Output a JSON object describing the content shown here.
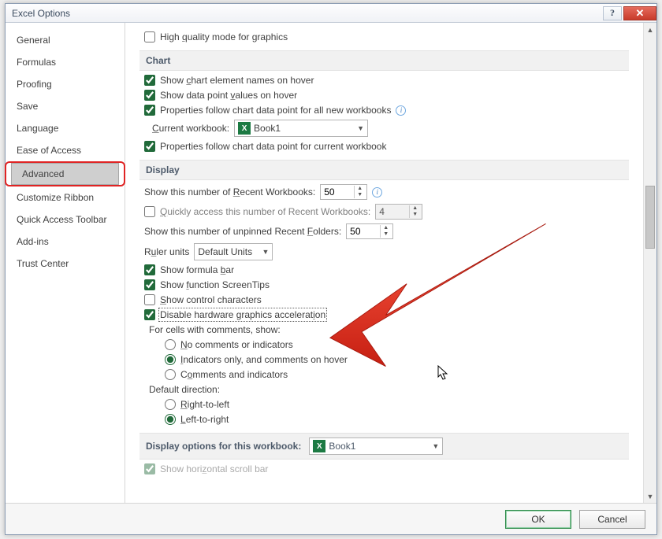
{
  "title": "Excel Options",
  "sidebar": {
    "items": [
      {
        "label": "General"
      },
      {
        "label": "Formulas"
      },
      {
        "label": "Proofing"
      },
      {
        "label": "Save"
      },
      {
        "label": "Language"
      },
      {
        "label": "Ease of Access"
      },
      {
        "label": "Advanced"
      },
      {
        "label": "Customize Ribbon"
      },
      {
        "label": "Quick Access Toolbar"
      },
      {
        "label": "Add-ins"
      },
      {
        "label": "Trust Center"
      }
    ],
    "selected_index": 6
  },
  "top_option": {
    "label": "High quality mode for graphics"
  },
  "chart_section": {
    "title": "Chart",
    "show_names": {
      "label": "Show chart element names on hover",
      "checked": true
    },
    "show_values": {
      "label": "Show data point values on hover",
      "checked": true
    },
    "props_all": {
      "label": "Properties follow chart data point for all new workbooks",
      "checked": true
    },
    "current_workbook_label": "Current workbook:",
    "current_workbook_value": "Book1",
    "props_current": {
      "label": "Properties follow chart data point for current workbook",
      "checked": true
    }
  },
  "display_section": {
    "title": "Display",
    "recent_workbooks_label": "Show this number of Recent Workbooks:",
    "recent_workbooks_value": "50",
    "quick_access": {
      "label": "Quickly access this number of Recent Workbooks:",
      "checked": false,
      "value": "4"
    },
    "recent_folders_label": "Show this number of unpinned Recent Folders:",
    "recent_folders_value": "50",
    "ruler_units_label": "Ruler units",
    "ruler_units_value": "Default Units",
    "formula_bar": {
      "label": "Show formula bar",
      "checked": true
    },
    "screentips": {
      "label": "Show function ScreenTips",
      "checked": true
    },
    "control_chars": {
      "label": "Show control characters",
      "checked": false
    },
    "disable_hw": {
      "label": "Disable hardware graphics acceleration",
      "checked": true
    },
    "comments_header": "For cells with comments, show:",
    "comments": {
      "none": "No comments or indicators",
      "indicators": "Indicators only, and comments on hover",
      "both": "Comments and indicators",
      "selected": "indicators"
    },
    "direction_header": "Default direction:",
    "direction": {
      "rtl": "Right-to-left",
      "ltr": "Left-to-right",
      "selected": "ltr"
    }
  },
  "workbook_display_section": {
    "title": "Display options for this workbook:",
    "value": "Book1",
    "hscroll": {
      "label": "Show horizontal scroll bar",
      "checked": true
    }
  },
  "buttons": {
    "ok": "OK",
    "cancel": "Cancel"
  }
}
